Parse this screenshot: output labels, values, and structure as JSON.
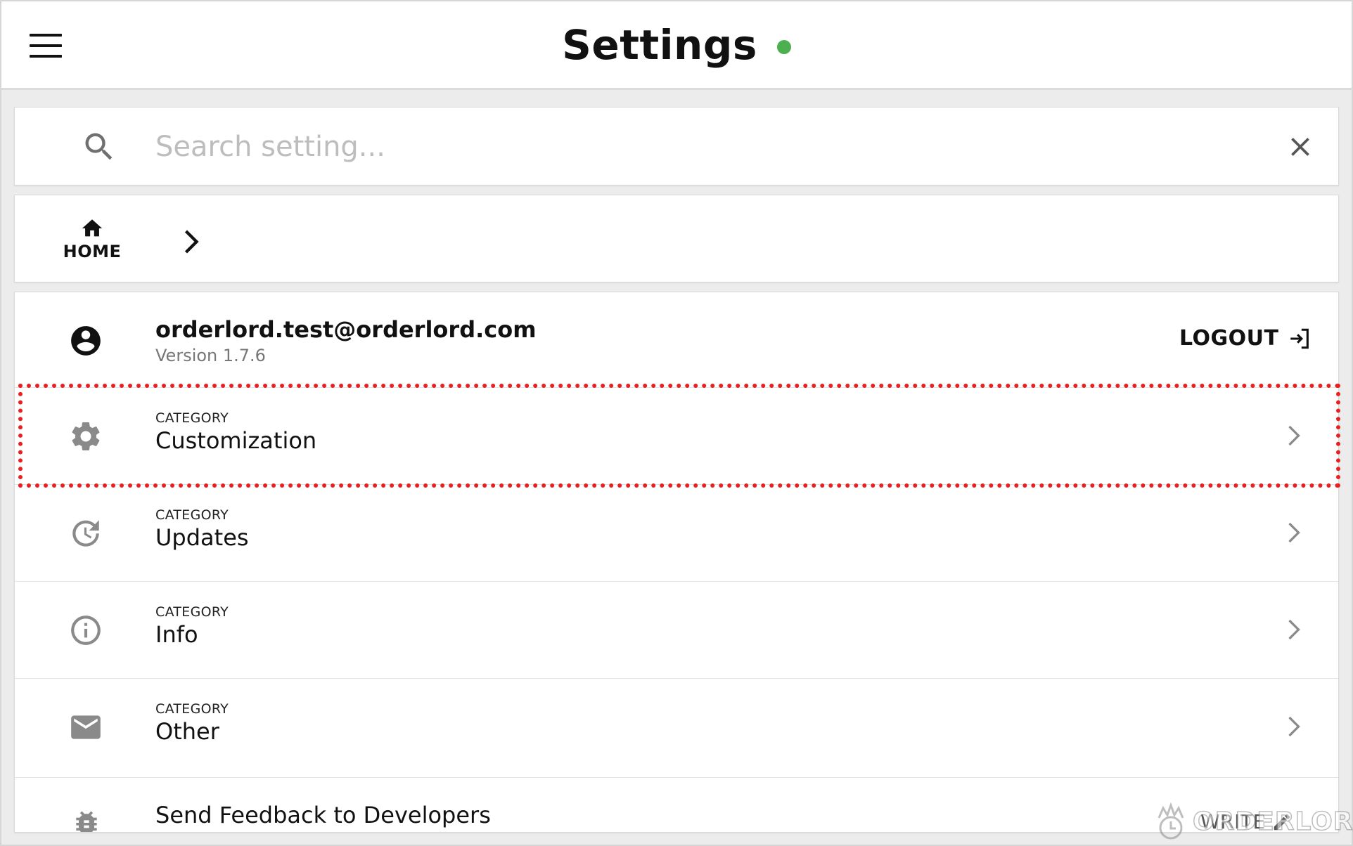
{
  "header": {
    "title": "Settings",
    "status_color": "#4caf50",
    "menu_icon": "hamburger-menu-icon"
  },
  "search": {
    "placeholder": "Search setting...",
    "value": "",
    "search_icon": "search-icon",
    "clear_icon": "close-icon"
  },
  "breadcrumb": {
    "home_label": "HOME",
    "home_icon": "home-icon",
    "separator_icon": "chevron-right-icon"
  },
  "account": {
    "email": "orderlord.test@orderlord.com",
    "version": "Version 1.7.6",
    "logout_label": "LOGOUT",
    "avatar_icon": "account-circle-icon",
    "logout_icon": "logout-icon"
  },
  "categories": [
    {
      "small_label": "CATEGORY",
      "name": "Customization",
      "icon": "gear-icon",
      "highlighted": true
    },
    {
      "small_label": "CATEGORY",
      "name": "Updates",
      "icon": "update-icon",
      "highlighted": false
    },
    {
      "small_label": "CATEGORY",
      "name": "Info",
      "icon": "info-icon",
      "highlighted": false
    },
    {
      "small_label": "CATEGORY",
      "name": "Other",
      "icon": "mail-icon",
      "highlighted": false
    }
  ],
  "feedback": {
    "label": "Send Feedback to Developers",
    "action_label": "WRITE",
    "icon": "bug-icon",
    "action_icon": "pencil-icon"
  },
  "watermark": {
    "text": "ORDERLORD"
  },
  "colors": {
    "highlight_border": "#e8201f",
    "icon_gray": "#8a8a8a"
  }
}
